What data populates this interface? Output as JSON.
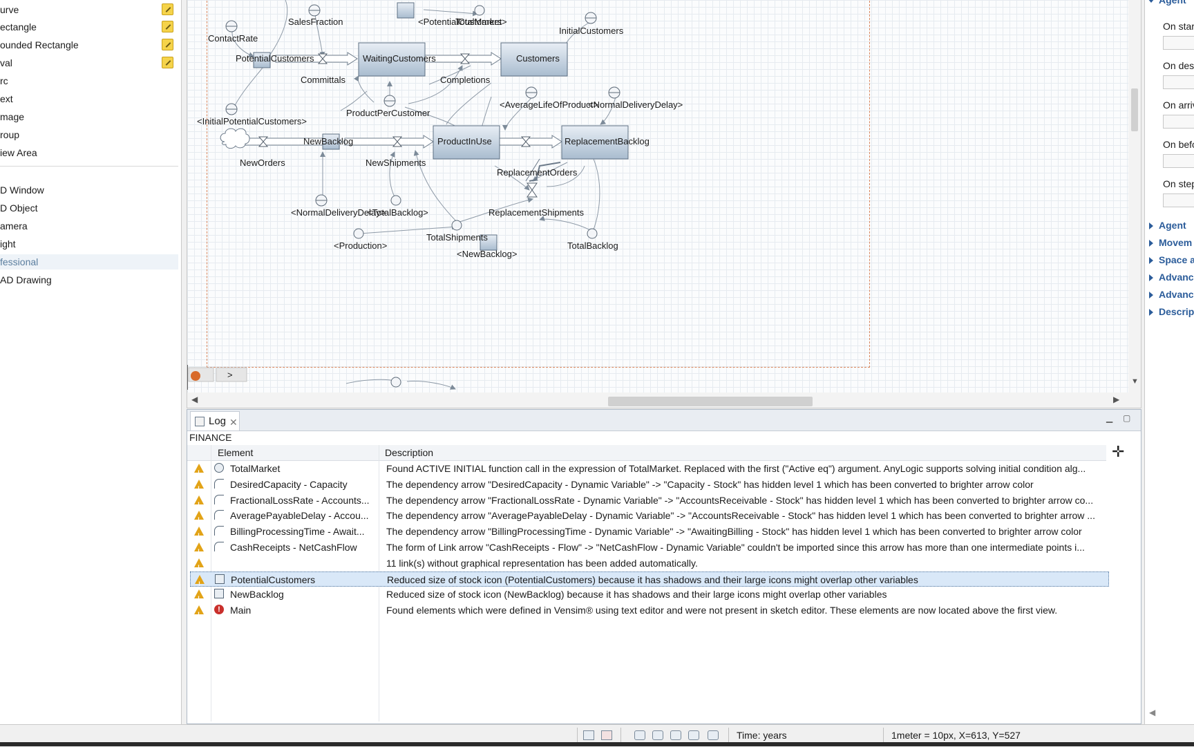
{
  "palette": {
    "items": [
      {
        "label": "urve",
        "editable": true
      },
      {
        "label": "ectangle",
        "editable": true
      },
      {
        "label": "ounded Rectangle",
        "editable": true
      },
      {
        "label": "val",
        "editable": true
      },
      {
        "label": "rc",
        "editable": false
      },
      {
        "label": "ext",
        "editable": false
      },
      {
        "label": "mage",
        "editable": false
      },
      {
        "label": "roup",
        "editable": false
      },
      {
        "label": "iew Area",
        "editable": false
      }
    ],
    "items_3d": [
      {
        "label": "D Window"
      },
      {
        "label": "D Object"
      },
      {
        "label": "amera"
      },
      {
        "label": "ight"
      }
    ],
    "group_professional": "fessional",
    "items_professional": [
      {
        "label": "AD Drawing"
      }
    ]
  },
  "diagram": {
    "labels": {
      "contact_rate": "ContactRate",
      "sales_fraction": "SalesFraction",
      "potential_customers_shadow": "<PotentialCustomers>",
      "total_market": "TotalMarket",
      "initial_customers": "InitialCustomers",
      "potential_customers": "PotentialCustomers",
      "waiting_customers": "WaitingCustomers",
      "customers": "Customers",
      "committals": "Committals",
      "completions": "Completions",
      "initial_potential_customers": "<InitialPotentialCustomers>",
      "product_per_customer": "ProductPerCustomer",
      "average_life_of_product": "<AverageLifeOfProduct>",
      "normal_delivery_delay_top": "<NormalDeliveryDelay>",
      "new_orders": "NewOrders",
      "new_backlog": "NewBacklog",
      "new_shipments": "NewShipments",
      "product_in_use": "ProductInUse",
      "replacement_backlog": "ReplacementBacklog",
      "replacement_orders": "ReplacementOrders",
      "normal_delivery_delay_bottom": "<NormalDeliveryDelay>",
      "total_backlog_shadow": "<TotalBacklog>",
      "replacement_shipments": "ReplacementShipments",
      "production": "<Production>",
      "total_shipments": "TotalShipments",
      "new_backlog_shadow": "<NewBacklog>",
      "total_backlog": "TotalBacklog"
    },
    "page_nav_next": ">"
  },
  "log": {
    "tab_label": "Log",
    "model_name": "FINANCE",
    "columns": {
      "element": "Element",
      "description": "Description"
    },
    "rows": [
      {
        "icon": "circle",
        "element": "TotalMarket",
        "description": "Found ACTIVE INITIAL function call in the expression of TotalMarket. Replaced with the first (\"Active eq\") argument. AnyLogic supports solving initial condition alg..."
      },
      {
        "icon": "arrow",
        "element": "DesiredCapacity - Capacity",
        "description": "The dependency arrow \"DesiredCapacity - Dynamic Variable\" -> \"Capacity - Stock\" has hidden level 1 which has been converted to brighter arrow color"
      },
      {
        "icon": "arrow",
        "element": "FractionalLossRate - Accounts...",
        "description": "The dependency arrow \"FractionalLossRate - Dynamic Variable\" -> \"AccountsReceivable - Stock\" has hidden level 1 which has been converted to brighter arrow co..."
      },
      {
        "icon": "arrow",
        "element": "AveragePayableDelay - Accou...",
        "description": "The dependency arrow \"AveragePayableDelay - Dynamic Variable\" -> \"AccountsReceivable - Stock\" has hidden level 1 which has been converted to brighter arrow ..."
      },
      {
        "icon": "arrow",
        "element": "BillingProcessingTime - Await...",
        "description": "The dependency arrow \"BillingProcessingTime - Dynamic Variable\" -> \"AwaitingBilling - Stock\" has hidden level 1 which has been converted to brighter arrow color"
      },
      {
        "icon": "arrow",
        "element": "CashReceipts - NetCashFlow",
        "description": "The form of Link arrow \"CashReceipts - Flow\" -> \"NetCashFlow - Dynamic Variable\" couldn't be imported since this arrow has more than one intermediate points i..."
      },
      {
        "icon": "none",
        "element": "",
        "description": "11 link(s) without graphical representation has been added automatically."
      },
      {
        "icon": "square",
        "element": "PotentialCustomers",
        "description": "Reduced size of stock icon (PotentialCustomers) because it has shadows and their large icons might overlap other variables",
        "selected": true
      },
      {
        "icon": "square",
        "element": "NewBacklog",
        "description": "Reduced size of stock icon (NewBacklog) because it has shadows and their large icons might overlap other variables"
      },
      {
        "icon": "error",
        "element": "Main",
        "description": "Found elements which were defined in Vensim® using text editor and were not present in sketch editor. These elements are now located above the first view."
      }
    ]
  },
  "properties": {
    "section_top": "Agent",
    "fields": [
      {
        "label": "On star"
      },
      {
        "label": "On des"
      },
      {
        "label": "On arriv"
      },
      {
        "label": "On befo"
      },
      {
        "label": "On step"
      }
    ],
    "sections": [
      "Agent",
      "Movem",
      "Space a",
      "Advanc",
      "Advanc",
      "Descrip"
    ]
  },
  "statusbar": {
    "time_units": "Time: years",
    "scale_info": "1meter = 10px, X=613, Y=527"
  },
  "colors": {
    "stock_fill_top": "#e8eef5",
    "stock_fill_bottom": "#a9bccf",
    "selection": "#d9e8f8",
    "warning": "#e2a317",
    "error": "#c9302c",
    "frame": "#d9845a"
  }
}
